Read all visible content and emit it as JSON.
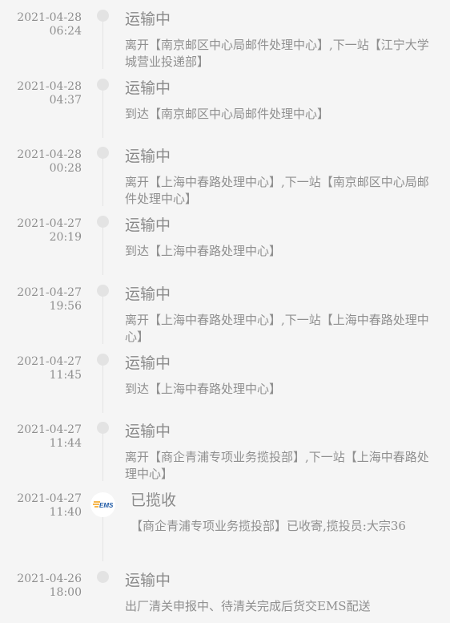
{
  "events": [
    {
      "date": "2021-04-28",
      "time": "06:24",
      "status": "运输中",
      "detail": "离开【南京邮区中心局邮件处理中心】,下一站【江宁大学城营业投递部】"
    },
    {
      "date": "2021-04-28",
      "time": "04:37",
      "status": "运输中",
      "detail": "到达【南京邮区中心局邮件处理中心】"
    },
    {
      "date": "2021-04-28",
      "time": "00:28",
      "status": "运输中",
      "detail": "离开【上海中春路处理中心】,下一站【南京邮区中心局邮件处理中心】"
    },
    {
      "date": "2021-04-27",
      "time": "20:19",
      "status": "运输中",
      "detail": "到达【上海中春路处理中心】"
    },
    {
      "date": "2021-04-27",
      "time": "19:56",
      "status": "运输中",
      "detail": "离开【上海中春路处理中心】,下一站【上海中春路处理中心】"
    },
    {
      "date": "2021-04-27",
      "time": "11:45",
      "status": "运输中",
      "detail": "到达【上海中春路处理中心】"
    },
    {
      "date": "2021-04-27",
      "time": "11:44",
      "status": "运输中",
      "detail": "离开【商企青浦专项业务揽投部】,下一站【上海中春路处理中心】"
    },
    {
      "date": "2021-04-27",
      "time": "11:40",
      "status": "已揽收",
      "detail": "【商企青浦专项业务揽投部】已收寄,揽投员:大宗36",
      "icon": "ems-logo-icon"
    },
    {
      "date": "2021-04-26",
      "time": "18:00",
      "status": "运输中",
      "detail": "出厂清关申报中、待清关完成后货交EMS配送"
    }
  ],
  "colors": {
    "background": "#f5f5f5",
    "text": "#8f8f8f",
    "dot": "#e3e3e3",
    "ems_blue": "#1f5aa6",
    "ems_orange": "#f39800"
  }
}
